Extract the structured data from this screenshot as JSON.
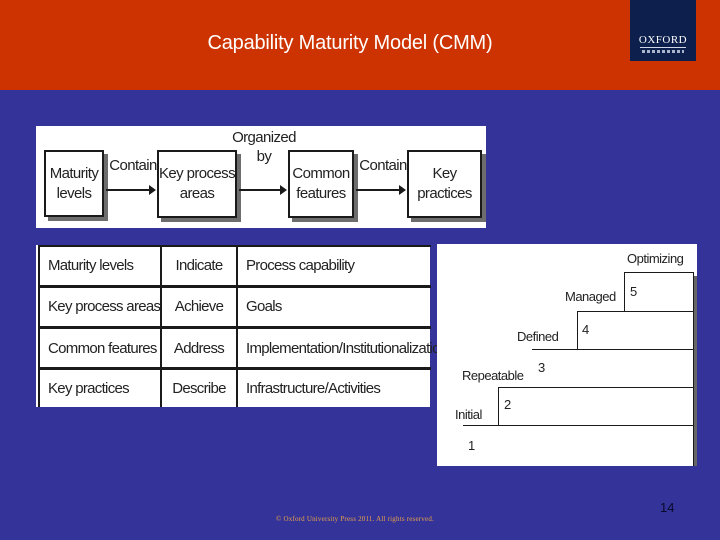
{
  "header": {
    "title": "Capability Maturity Model (CMM)",
    "logo_text": "OXFORD",
    "background_color": "#cc3300",
    "logo_color": "#0d1f4d"
  },
  "slide": {
    "background_color": "#333399",
    "page_number": "14",
    "copyright": "© Oxford University Press 2011. All rights reserved."
  },
  "flow_diagram": {
    "boxes": [
      {
        "line1": "Maturity",
        "line2": "levels"
      },
      {
        "line1": "Key process",
        "line2": "areas"
      },
      {
        "line1": "Common",
        "line2": "features"
      },
      {
        "line1": "Key",
        "line2": "practices"
      }
    ],
    "arrows": [
      {
        "label_line1": "Contain",
        "label_line2": ""
      },
      {
        "label_line1": "Organized",
        "label_line2": "by"
      },
      {
        "label_line1": "Contain",
        "label_line2": ""
      }
    ]
  },
  "relation_table": {
    "rows": [
      {
        "subject": "Maturity levels",
        "verb": "Indicate",
        "object": "Process capability"
      },
      {
        "subject": "Key process areas",
        "verb": "Achieve",
        "object": "Goals"
      },
      {
        "subject": "Common features",
        "verb": "Address",
        "object": "Implementation/Institutionalization"
      },
      {
        "subject": "Key practices",
        "verb": "Describe",
        "object": "Infrastructure/Activities"
      }
    ]
  },
  "maturity_staircase": {
    "levels": [
      {
        "number": "1",
        "name": "Initial"
      },
      {
        "number": "2",
        "name": "Repeatable"
      },
      {
        "number": "3",
        "name": "Defined"
      },
      {
        "number": "4",
        "name": "Managed"
      },
      {
        "number": "5",
        "name": "Optimizing"
      }
    ]
  }
}
